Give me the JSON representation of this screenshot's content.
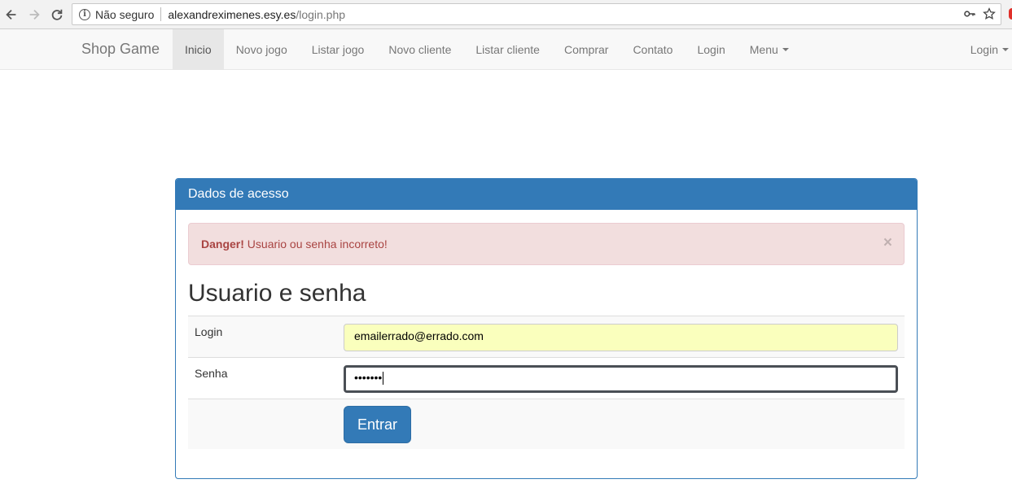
{
  "browser": {
    "security_label": "Não seguro",
    "url_host": "alexandreximenes.esy.es",
    "url_path": "/login.php"
  },
  "navbar": {
    "brand": "Shop Game",
    "items": [
      {
        "label": "Inicio",
        "active": true
      },
      {
        "label": "Novo jogo"
      },
      {
        "label": "Listar jogo"
      },
      {
        "label": "Novo cliente"
      },
      {
        "label": "Listar cliente"
      },
      {
        "label": "Comprar"
      },
      {
        "label": "Contato"
      },
      {
        "label": "Login"
      },
      {
        "label": "Menu"
      }
    ],
    "right_login": "Login"
  },
  "panel": {
    "heading": "Dados de acesso",
    "alert": {
      "strong": "Danger!",
      "message": " Usuario ou senha incorreto!",
      "close": "×"
    },
    "title": "Usuario e senha",
    "form": {
      "login_label": "Login",
      "login_value": "emailerrado@errado.com",
      "senha_label": "Senha",
      "senha_masked": "•••••••",
      "submit_label": "Entrar"
    }
  },
  "colors": {
    "primary": "#337ab7",
    "danger_bg": "#f2dede",
    "danger_text": "#a94442",
    "autofill": "#faffbd"
  }
}
